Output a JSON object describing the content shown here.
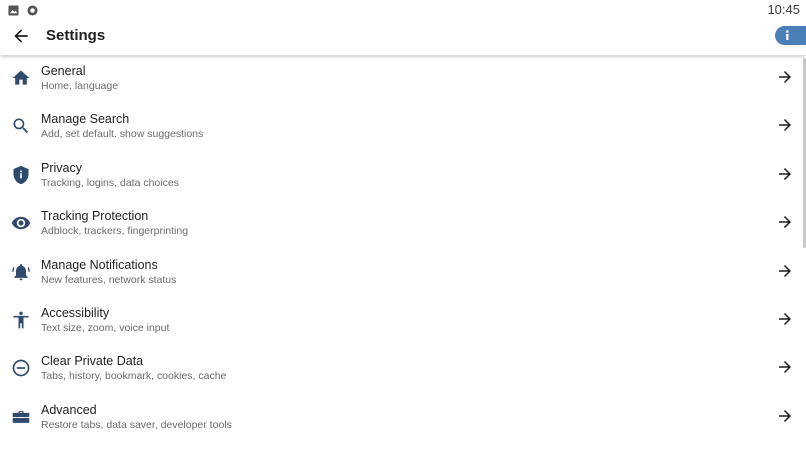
{
  "status_bar": {
    "time": "10:45",
    "icons": [
      "image-icon",
      "circle-icon"
    ]
  },
  "toolbar": {
    "title": "Settings",
    "info_icon": "info-icon"
  },
  "settings": [
    {
      "label": "General",
      "sub": "Home, language",
      "icon": "home-icon"
    },
    {
      "label": "Manage Search",
      "sub": "Add, set default. show suggestions",
      "icon": "search-icon"
    },
    {
      "label": "Privacy",
      "sub": "Tracking, logins, data choices",
      "icon": "shield-icon"
    },
    {
      "label": "Tracking Protection",
      "sub": "Adblock, trackers, fingerprinting",
      "icon": "eye-icon"
    },
    {
      "label": "Manage Notifications",
      "sub": "New features, network status",
      "icon": "bell-icon"
    },
    {
      "label": "Accessibility",
      "sub": "Text size, zoom, voice input",
      "icon": "accessibility-icon"
    },
    {
      "label": "Clear Private Data",
      "sub": "Tabs, history, bookmark, cookies, cache",
      "icon": "minus-circle-icon"
    },
    {
      "label": "Advanced",
      "sub": "Restore tabs, data saver, developer tools",
      "icon": "toolbox-icon"
    }
  ],
  "colors": {
    "icon": "#2f4a6d",
    "info_badge": "#4a7fb8"
  }
}
